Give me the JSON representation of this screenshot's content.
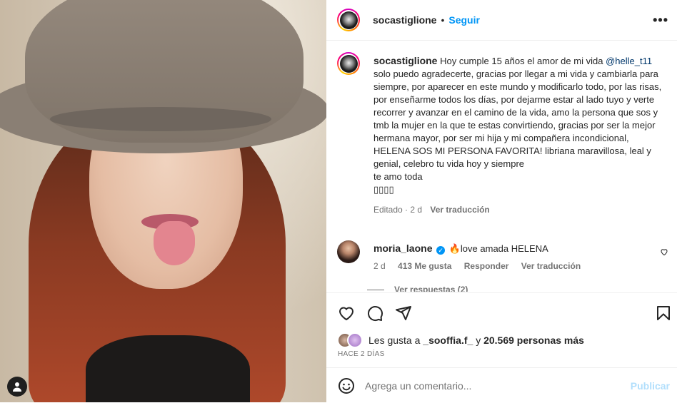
{
  "post": {
    "username": "socastiglione",
    "follow_label": "Seguir",
    "separator": "•",
    "more_label": "•••",
    "photo_user_tag_icon": "person-icon"
  },
  "caption": {
    "username": "socastiglione",
    "text_part1": "Hoy cumple 15 años el amor de mi vida",
    "mention": "@helle_t11",
    "text_part2": "solo puedo agradecerte, gracias por llegar a mi vida y cambiarla para siempre, por aparecer en este mundo y modificarlo todo, por las risas, por enseñarme todos los días, por dejarme estar al lado tuyo y verte recorrer y avanzar en el camino de la vida, amo la persona que sos y tmb la mujer en la que te estas convirtiendo, gracias por ser la mejor hermana mayor, por ser mi hija y mi compañera incondicional, HELENA SOS MI PERSONA FAVORITA! libriana maravillosa, leal y genial, celebro tu vida hoy y siempre",
    "text_part3": "te amo toda",
    "emoji_line": "▯▯▯▯",
    "edited": "Editado · 2 d",
    "translate": "Ver traducción"
  },
  "comment": {
    "username": "moria_laone",
    "verified_icon": "verified-badge-icon",
    "text": "🔥love amada HELENA",
    "age": "2 d",
    "likes": "413 Me gusta",
    "reply": "Responder",
    "translate": "Ver traducción",
    "more_replies": "Ver respuestas (2)"
  },
  "likes": {
    "prefix": "Les gusta a",
    "user": "_sooffia.f_",
    "middle": "y",
    "count": "20.569 personas más"
  },
  "time_ago": "HACE 2 DÍAS",
  "add_comment": {
    "placeholder": "Agrega un comentario...",
    "post_label": "Publicar"
  },
  "colors": {
    "accent": "#0095f6",
    "mention": "#00376b",
    "muted": "#737373",
    "post_disabled": "#b2dffc"
  }
}
